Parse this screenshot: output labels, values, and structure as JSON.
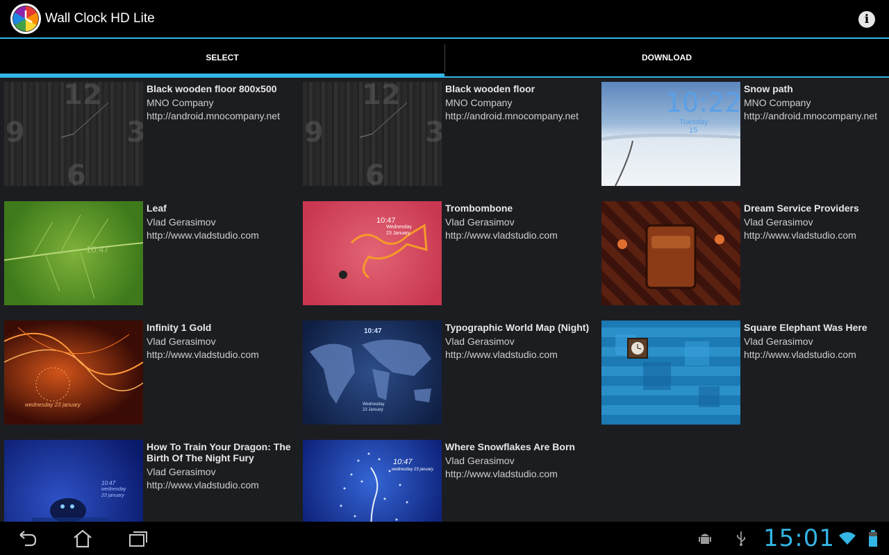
{
  "app": {
    "title": "Wall Clock HD Lite",
    "icon": "app-clock-icon"
  },
  "tabs": [
    {
      "label": "SELECT",
      "selected": true
    },
    {
      "label": "DOWNLOAD",
      "selected": false
    }
  ],
  "items": [
    {
      "title": "Black wooden floor 800x500",
      "author": "MNO Company",
      "url": "http://android.mnocompany.net"
    },
    {
      "title": "Black wooden floor",
      "author": "MNO Company",
      "url": "http://android.mnocompany.net"
    },
    {
      "title": "Snow path",
      "author": "MNO Company",
      "url": "http://android.mnocompany.net"
    },
    {
      "title": "Leaf",
      "author": "Vlad Gerasimov",
      "url": "http://www.vladstudio.com"
    },
    {
      "title": "Trombombone",
      "author": "Vlad Gerasimov",
      "url": "http://www.vladstudio.com"
    },
    {
      "title": "Dream Service Providers",
      "author": "Vlad Gerasimov",
      "url": "http://www.vladstudio.com"
    },
    {
      "title": "Infinity 1 Gold",
      "author": "Vlad Gerasimov",
      "url": "http://www.vladstudio.com"
    },
    {
      "title": "Typographic World Map (Night)",
      "author": "Vlad Gerasimov",
      "url": "http://www.vladstudio.com"
    },
    {
      "title": "Square Elephant Was Here",
      "author": "Vlad Gerasimov",
      "url": "http://www.vladstudio.com"
    },
    {
      "title": "How To Train Your Dragon: The Birth Of The Night Fury",
      "author": "Vlad Gerasimov",
      "url": "http://www.vladstudio.com"
    },
    {
      "title": "Where Snowflakes Are Born",
      "author": "Vlad Gerasimov",
      "url": "http://www.vladstudio.com"
    }
  ],
  "thumb_text": {
    "wood_numbers": [
      "12",
      "9",
      "3",
      "6"
    ],
    "snow_time": "10:22",
    "snow_day": "Tuesday",
    "snow_date": "15",
    "leaf_time": "10:47",
    "trombone_time": "10:47",
    "trombone_day": "Wednesday",
    "trombone_date": "23 January",
    "infinity_date": "wednesday 23 january",
    "map_time": "10:47",
    "map_day": "Wednesday",
    "map_date": "23 January",
    "dragon_time": "10:47",
    "dragon_day": "wednesday",
    "dragon_date": "23 january",
    "snowflake_time": "10:47",
    "snowflake_date": "wednesday 23 january"
  },
  "navbar": {
    "back_icon": "back-icon",
    "home_icon": "home-icon",
    "recents_icon": "recent-apps-icon",
    "android_icon": "android-debug-icon",
    "usb_icon": "usb-icon",
    "wifi_icon": "wifi-icon",
    "battery_icon": "battery-icon",
    "time": "15:01"
  },
  "colors": {
    "accent": "#33b5e5",
    "background": "#1c1d21"
  }
}
